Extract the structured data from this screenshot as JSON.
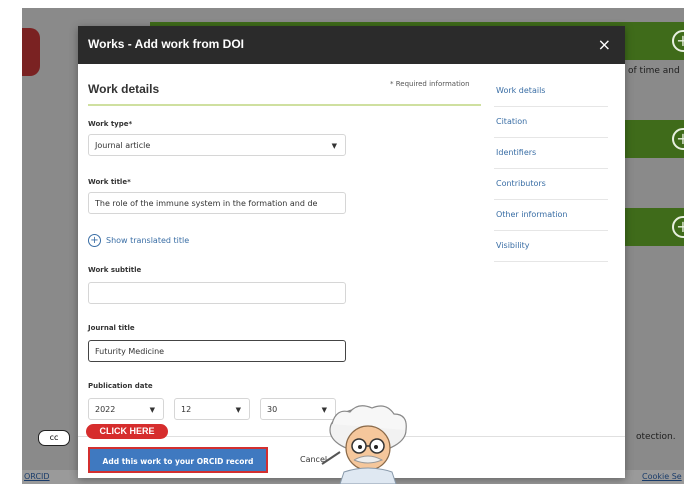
{
  "background": {
    "right_text_1": "of time and",
    "right_text_2": "otection.",
    "footer_left": "ORCID",
    "footer_right": "Cookie Se"
  },
  "modal": {
    "title": "Works - Add work from DOI",
    "close_label": "×",
    "section_title": "Work details",
    "required_note": "* Required information",
    "work_type": {
      "label": "Work type*",
      "value": "Journal article"
    },
    "work_title": {
      "label": "Work title*",
      "value": "The role of the immune system in the formation and de"
    },
    "show_translated": "Show translated title",
    "work_subtitle": {
      "label": "Work subtitle",
      "value": ""
    },
    "journal_title": {
      "label": "Journal title",
      "value": "Futurity Medicine"
    },
    "publication_date": {
      "label": "Publication date",
      "year": "2022",
      "month": "12",
      "day": "30"
    },
    "add_button": "Add this work to your ORCID record",
    "cancel_button": "Cancel"
  },
  "side_nav": {
    "items": [
      {
        "label": "Work details"
      },
      {
        "label": "Citation"
      },
      {
        "label": "Identifiers"
      },
      {
        "label": "Contributors"
      },
      {
        "label": "Other information"
      },
      {
        "label": "Visibility"
      }
    ]
  },
  "tutorial": {
    "click_here": "CLICK HERE"
  },
  "colors": {
    "header_bg": "#2b2b2b",
    "primary_button": "#3f79c0",
    "highlight_red": "#d62d2d",
    "bg_green": "#3f6b1a",
    "link_blue": "#3a6ea5"
  },
  "icons": [
    "plus-circle-icon",
    "close-icon",
    "chevron-down-icon",
    "cc-license-icon",
    "mascot-professor"
  ]
}
